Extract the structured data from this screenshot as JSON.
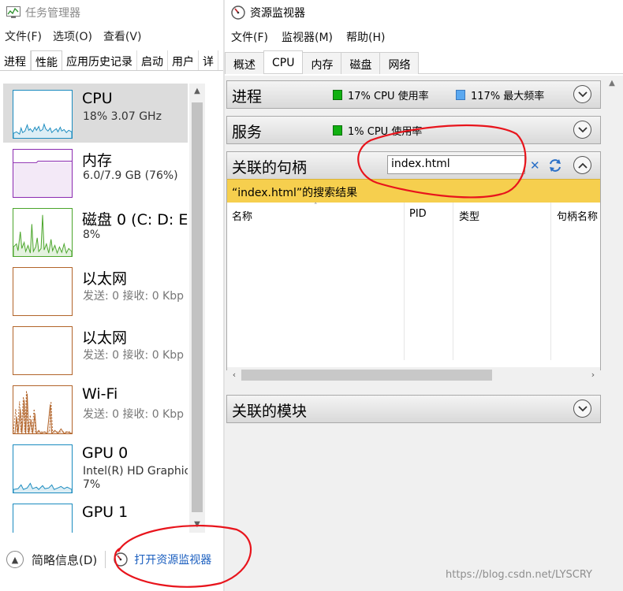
{
  "task_manager": {
    "title": "任务管理器",
    "menu": [
      "文件(F)",
      "选项(O)",
      "查看(V)"
    ],
    "tabs": [
      "进程",
      "性能",
      "应用历史记录",
      "启动",
      "用户",
      "详"
    ],
    "active_tab": "性能",
    "items": [
      {
        "name": "CPU",
        "sub": "18% 3.07 GHz",
        "color": "#1a8bbf",
        "icon": "cpu-graph-icon"
      },
      {
        "name": "内存",
        "sub": "6.0/7.9 GB (76%)",
        "color": "#8b2ab0",
        "icon": "memory-graph-icon"
      },
      {
        "name": "磁盘 0 (C: D: E:",
        "sub": "8%",
        "color": "#4aa52a",
        "icon": "disk-graph-icon"
      },
      {
        "name": "以太网",
        "sub": "发送: 0 接收: 0 Kbp",
        "color": "#b2642a",
        "icon": "ethernet-graph-icon"
      },
      {
        "name": "以太网",
        "sub": "发送: 0 接收: 0 Kbp",
        "color": "#b2642a",
        "icon": "ethernet-graph-icon"
      },
      {
        "name": "Wi-Fi",
        "sub": "发送: 0 接收: 0 Kbp",
        "color": "#b2642a",
        "icon": "wifi-graph-icon"
      },
      {
        "name": "GPU 0",
        "sub": "Intel(R) HD Graphic",
        "sub2": "7%",
        "color": "#1a8bbf",
        "icon": "gpu-graph-icon"
      },
      {
        "name": "GPU 1",
        "sub": "",
        "color": "#1a8bbf",
        "icon": "gpu-graph-icon"
      }
    ],
    "footer": {
      "fewer_details": "简略信息(D)",
      "open_resmon": "打开资源监视器"
    }
  },
  "resource_monitor": {
    "title": "资源监视器",
    "menu": [
      "文件(F)",
      "监视器(M)",
      "帮助(H)"
    ],
    "tabs": [
      "概述",
      "CPU",
      "内存",
      "磁盘",
      "网络"
    ],
    "active_tab": "CPU",
    "panels": {
      "processes": {
        "title": "进程",
        "cpu_usage": "17% CPU 使用率",
        "max_freq": "117% 最大频率",
        "cpu_color": "#11b011",
        "freq_color": "#5aa8f0"
      },
      "services": {
        "title": "服务",
        "cpu_usage": "1% CPU 使用率",
        "cpu_color": "#11b011"
      },
      "handles": {
        "title": "关联的句柄",
        "search_value": "index.html",
        "result_banner": "“index.html”的搜索结果",
        "columns": [
          "名称",
          "PID",
          "类型",
          "句柄名称"
        ]
      },
      "modules": {
        "title": "关联的模块"
      }
    }
  },
  "watermark": "https://blog.csdn.net/LYSCRY"
}
